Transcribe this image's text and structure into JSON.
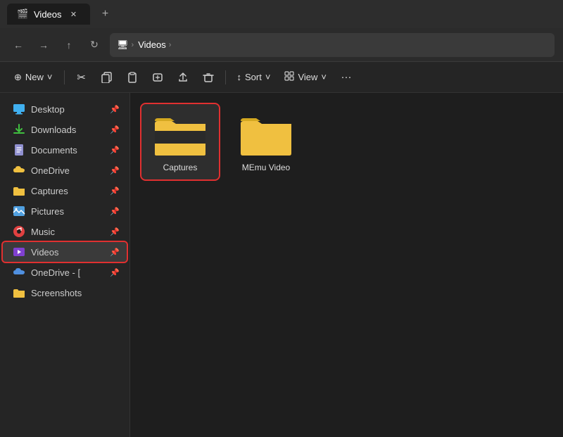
{
  "titleBar": {
    "tab": {
      "label": "Videos",
      "icon": "🎬"
    },
    "newTabLabel": "+"
  },
  "navBar": {
    "back": "←",
    "forward": "→",
    "up": "↑",
    "refresh": "↻",
    "addressParts": [
      {
        "label": "🖥",
        "chevron": ">"
      },
      {
        "label": "Videos",
        "chevron": ">"
      }
    ]
  },
  "toolbar": {
    "new_label": "New",
    "new_chevron": "˅",
    "cut_icon": "✂",
    "copy_icon": "⧉",
    "paste_icon": "📋",
    "rename_icon": "Aa",
    "share_icon": "⬆",
    "delete_icon": "🗑",
    "sort_label": "Sort",
    "sort_icon": "↕",
    "view_label": "View",
    "view_icon": "▦",
    "more_icon": "···"
  },
  "sidebar": {
    "items": [
      {
        "id": "desktop",
        "label": "Desktop",
        "icon": "🖥",
        "pinned": true,
        "active": false
      },
      {
        "id": "downloads",
        "label": "Downloads",
        "icon": "⬇",
        "pinned": true,
        "active": false
      },
      {
        "id": "documents",
        "label": "Documents",
        "icon": "📄",
        "pinned": true,
        "active": false
      },
      {
        "id": "onedrive",
        "label": "OneDrive",
        "icon": "📁",
        "pinned": true,
        "active": false
      },
      {
        "id": "captures",
        "label": "Captures",
        "icon": "📁",
        "pinned": true,
        "active": false
      },
      {
        "id": "pictures",
        "label": "Pictures",
        "icon": "🏔",
        "pinned": true,
        "active": false
      },
      {
        "id": "music",
        "label": "Music",
        "icon": "🎵",
        "pinned": true,
        "active": false
      },
      {
        "id": "videos",
        "label": "Videos",
        "icon": "🎬",
        "pinned": true,
        "active": true,
        "highlight": true
      },
      {
        "id": "onedrive2",
        "label": "OneDrive - [",
        "icon": "☁",
        "pinned": true,
        "active": false
      },
      {
        "id": "screenshots",
        "label": "Screenshots",
        "icon": "📁",
        "pinned": false,
        "active": false
      }
    ]
  },
  "files": [
    {
      "id": "captures",
      "label": "Captures",
      "selected": true
    },
    {
      "id": "memu-video",
      "label": "MEmu Video",
      "selected": false
    }
  ],
  "colors": {
    "folderBody": "#f0c040",
    "folderTab": "#d4a820",
    "folderDark": "#2a2a2a",
    "selectedBorder": "#e03030",
    "sidebarActiveBg": "#3a3a3a"
  }
}
